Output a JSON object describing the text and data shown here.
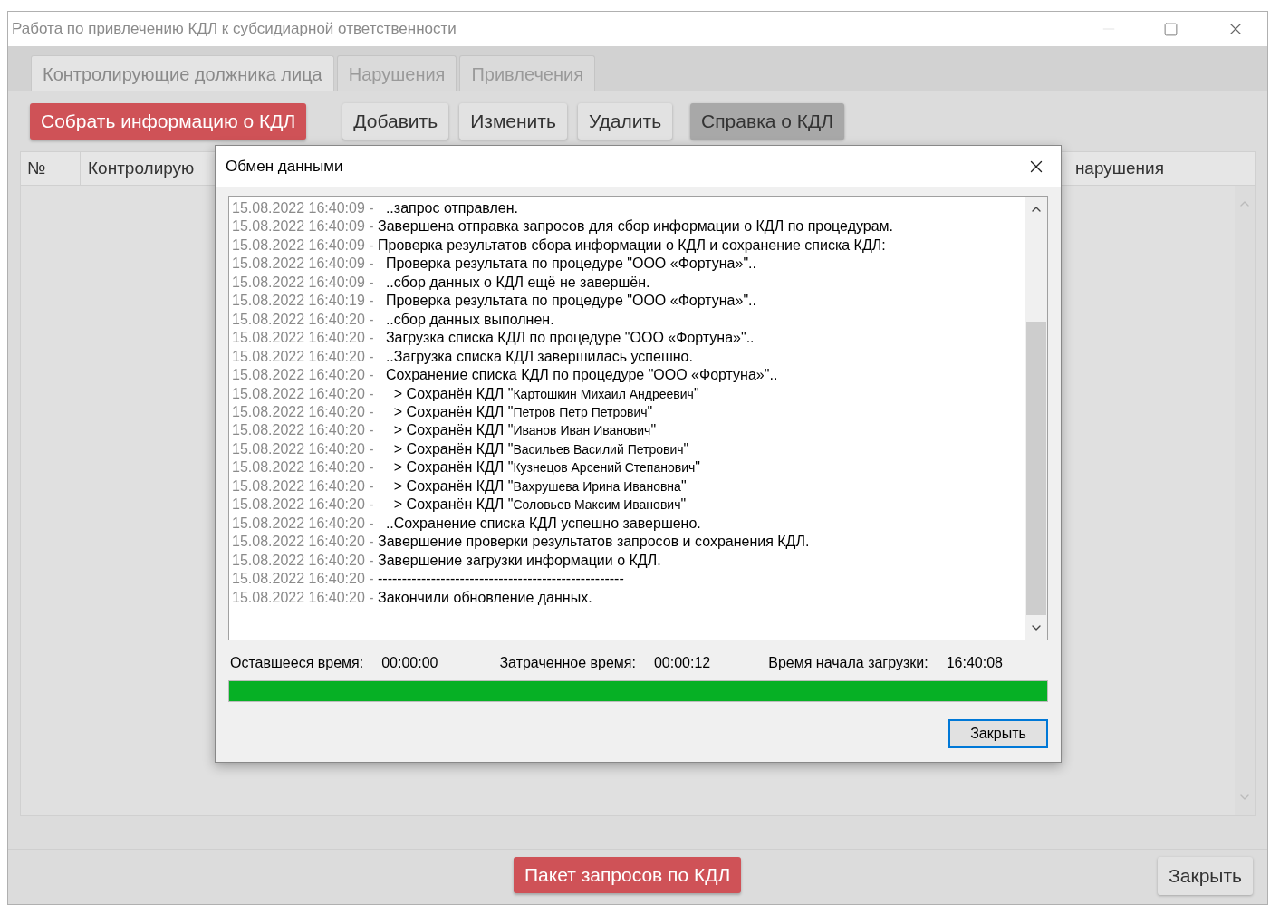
{
  "window": {
    "title": "Работа по привлечению КДЛ к субсидиарной ответственности"
  },
  "tabs": [
    {
      "label": "Контролирующие должника лица",
      "selected": true
    },
    {
      "label": "Нарушения",
      "selected": false
    },
    {
      "label": "Привлечения",
      "selected": false
    }
  ],
  "toolbar": [
    {
      "label": "Собрать информацию о КДЛ",
      "kind": "danger"
    },
    {
      "label": "Добавить",
      "kind": "default"
    },
    {
      "label": "Изменить",
      "kind": "default"
    },
    {
      "label": "Удалить",
      "kind": "default"
    },
    {
      "label": "Справка о КДЛ",
      "kind": "pressed"
    }
  ],
  "table": {
    "columns": [
      "№",
      "Контролирую",
      "нарушения"
    ]
  },
  "dialog": {
    "title": "Обмен данными",
    "log": [
      {
        "time": "15.08.2022 16:40:09 -",
        "text": "  ..запрос отправлен."
      },
      {
        "time": "15.08.2022 16:40:09 -",
        "text": "Завершена отправка запросов для сбор информации о КДЛ по процедурам."
      },
      {
        "time": "15.08.2022 16:40:09 -",
        "text": "Проверка результатов сбора информации о КДЛ и сохранение списка КДЛ:"
      },
      {
        "time": "15.08.2022 16:40:09 -",
        "text": "  Проверка результата по процедуре \"ООО «Фортуна»\".."
      },
      {
        "time": "15.08.2022 16:40:09 -",
        "text": "  ..сбор данных о КДЛ ещё не завершён."
      },
      {
        "time": "15.08.2022 16:40:19 -",
        "text": "  Проверка результата по процедуре \"ООО «Фортуна»\".."
      },
      {
        "time": "15.08.2022 16:40:20 -",
        "text": "  ..сбор данных выполнен."
      },
      {
        "time": "15.08.2022 16:40:20 -",
        "text": "  Загрузка списка КДЛ по процедуре \"ООО «Фортуна»\".."
      },
      {
        "time": "15.08.2022 16:40:20 -",
        "text": "  ..Загрузка списка КДЛ завершилась успешно."
      },
      {
        "time": "15.08.2022 16:40:20 -",
        "text": "  Сохранение списка КДЛ по процедуре \"ООО «Фортуна»\".."
      },
      {
        "time": "15.08.2022 16:40:20 -",
        "text": "    > Сохранён КДЛ \"",
        "name": "Картошкин Михаил Андреевич",
        "end": "\""
      },
      {
        "time": "15.08.2022 16:40:20 -",
        "text": "    > Сохранён КДЛ \"",
        "name": "Петров Петр Петрович",
        "end": "\""
      },
      {
        "time": "15.08.2022 16:40:20 -",
        "text": "    > Сохранён КДЛ \"",
        "name": "Иванов Иван Иванович",
        "end": "\""
      },
      {
        "time": "15.08.2022 16:40:20 -",
        "text": "    > Сохранён КДЛ \"",
        "name": "Васильев Василий Петрович",
        "end": "\""
      },
      {
        "time": "15.08.2022 16:40:20 -",
        "text": "    > Сохранён КДЛ \"",
        "name": "Кузнецов Арсений Степанович",
        "end": "\""
      },
      {
        "time": "15.08.2022 16:40:20 -",
        "text": "    > Сохранён КДЛ \"",
        "name": "Вахрушева Ирина Ивановна",
        "end": "\""
      },
      {
        "time": "15.08.2022 16:40:20 -",
        "text": "    > Сохранён КДЛ \"",
        "name": "Соловьев Максим Иванович",
        "end": "\""
      },
      {
        "time": "15.08.2022 16:40:20 -",
        "text": "  ..Сохранение списка КДЛ успешно завершено."
      },
      {
        "time": "15.08.2022 16:40:20 -",
        "text": "Завершение проверки результатов запросов и сохранения КДЛ."
      },
      {
        "time": "15.08.2022 16:40:20 -",
        "text": "Завершение загрузки информации о КДЛ."
      },
      {
        "time": "15.08.2022 16:40:20 -",
        "text": "---------------------------------------------------"
      },
      {
        "time": "15.08.2022 16:40:20 -",
        "text": "Закончили обновление данных."
      }
    ],
    "stats": [
      {
        "label": "Оставшееся время:",
        "value": "00:00:00"
      },
      {
        "label": "Затраченное время:",
        "value": "00:00:12"
      },
      {
        "label": "Время начала загрузки:",
        "value": "16:40:08"
      }
    ],
    "progress": {
      "level": 1
    },
    "close_button": "Закрыть"
  },
  "footer": {
    "primary_button": "Пакет запросов по КДЛ",
    "close_button": "Закрыть"
  }
}
